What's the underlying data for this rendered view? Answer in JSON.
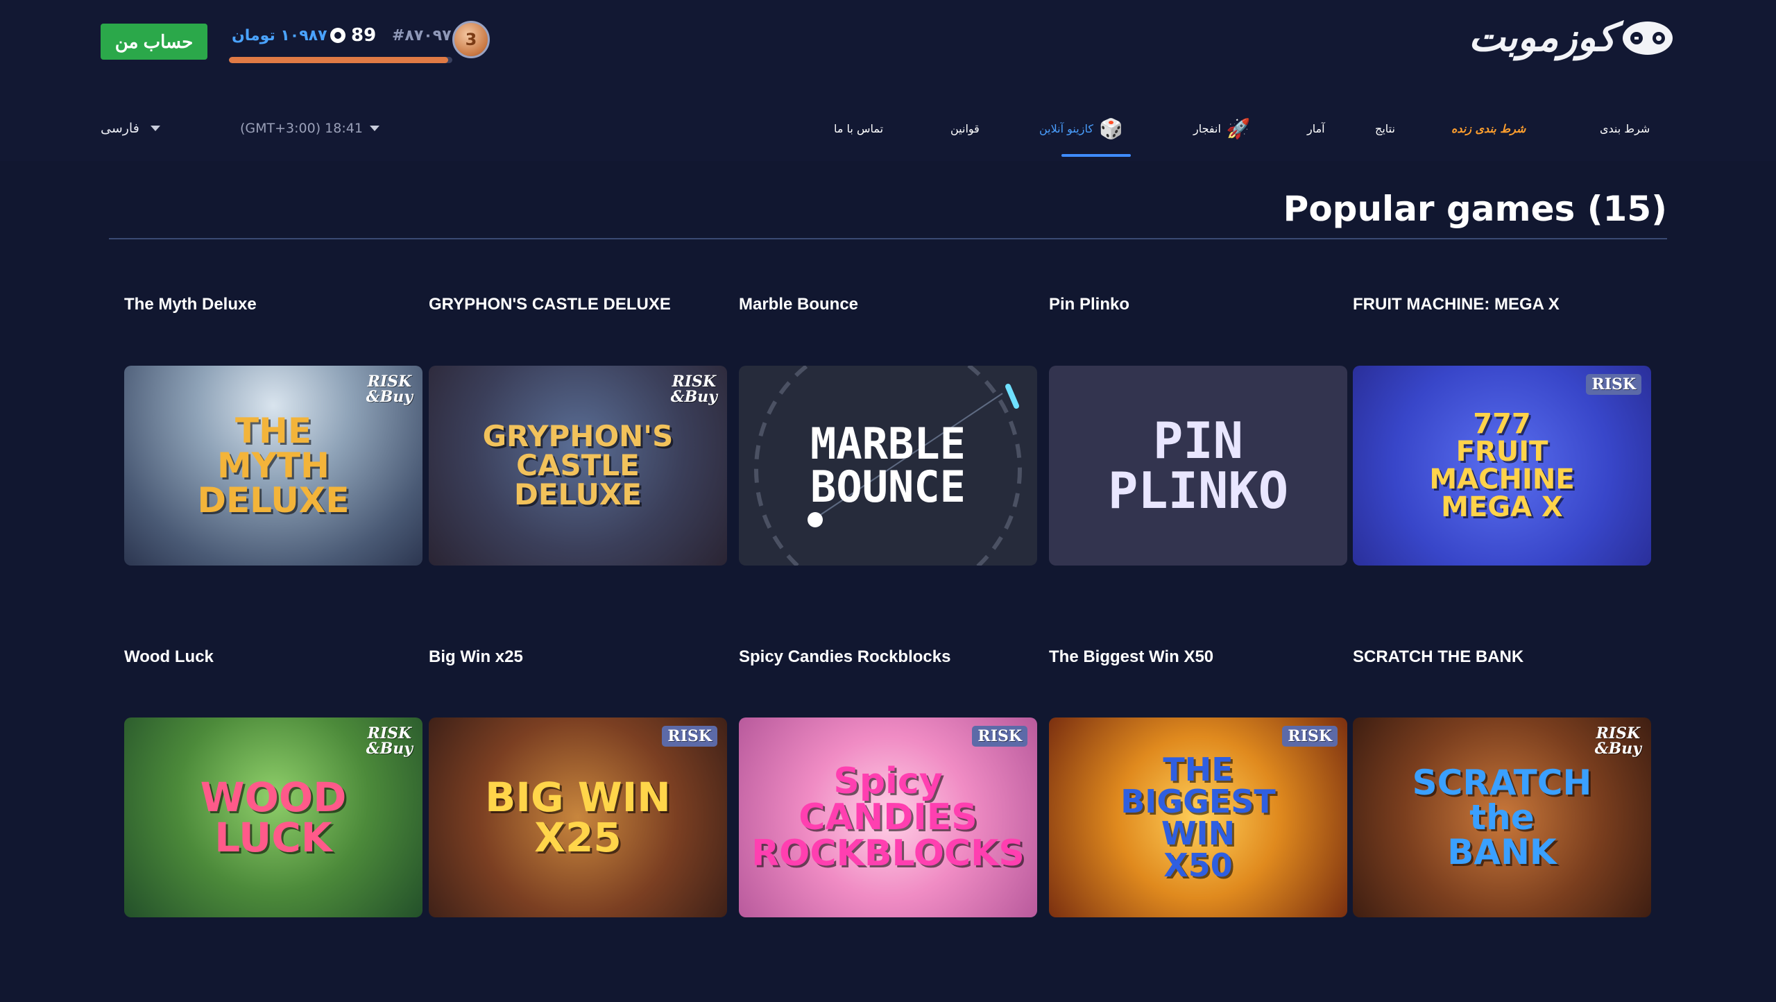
{
  "header": {
    "account_button": "حساب من",
    "balance": "۱۰۹۸۷ تومان",
    "coins": "89",
    "user_id": "#۸۷۰۹۷",
    "level": "3",
    "level_progress_percent": 98,
    "logo_text": "کوزموبت"
  },
  "nav": {
    "items": [
      {
        "label": "شرط بندی"
      },
      {
        "label": "شرط بندی زنده"
      },
      {
        "label": "نتایج"
      },
      {
        "label": "آمار"
      },
      {
        "label": "انفجار",
        "icon": "rocket-icon"
      },
      {
        "label": "کازینو آنلاین",
        "icon": "dice-icon",
        "active": true
      },
      {
        "label": "قوانین"
      },
      {
        "label": "تماس با ما"
      }
    ],
    "timezone": "(GMT+3:00) 18:41",
    "language": "فارسی"
  },
  "section": {
    "title": "Popular games (15)"
  },
  "games": [
    {
      "name": "The Myth Deluxe",
      "art": "THE\nMYTH\nDELUXE",
      "badge": "RISK\n&Buy"
    },
    {
      "name": "GRYPHON'S CASTLE DELUXE",
      "art": "GRYPHON'S\nCASTLE\nDELUXE",
      "badge": "RISK\n&Buy"
    },
    {
      "name": "Marble Bounce",
      "art": "MARBLE\nBOUNCE",
      "badge": ""
    },
    {
      "name": "Pin Plinko",
      "art": "PIN\nPLINKO",
      "badge": ""
    },
    {
      "name": "FRUIT MACHINE: MEGA X",
      "art": "777\nFRUIT\nMACHINE\nMEGA X",
      "badge": "RISK"
    },
    {
      "name": "Wood Luck",
      "art": "WOOD\nLUCK",
      "badge": "RISK\n&Buy"
    },
    {
      "name": "Big Win x25",
      "art": "BIG WIN\nx25",
      "badge": "RISK"
    },
    {
      "name": "Spicy Candies Rockblocks",
      "art": "Spicy\nCANDIES\nROCKBLOCKS",
      "badge": "RISK"
    },
    {
      "name": "The Biggest Win X50",
      "art": "THE\nBIGGEST\nWIN\nX50",
      "badge": "RISK"
    },
    {
      "name": "SCRATCH THE BANK",
      "art": "SCRATCH\nthe\nBANK",
      "badge": "RISK\n&Buy"
    }
  ],
  "colors": {
    "background": "#111730",
    "accent_green": "#2ba84a",
    "accent_blue": "#4a9fff",
    "accent_orange": "#ff9f2e"
  }
}
